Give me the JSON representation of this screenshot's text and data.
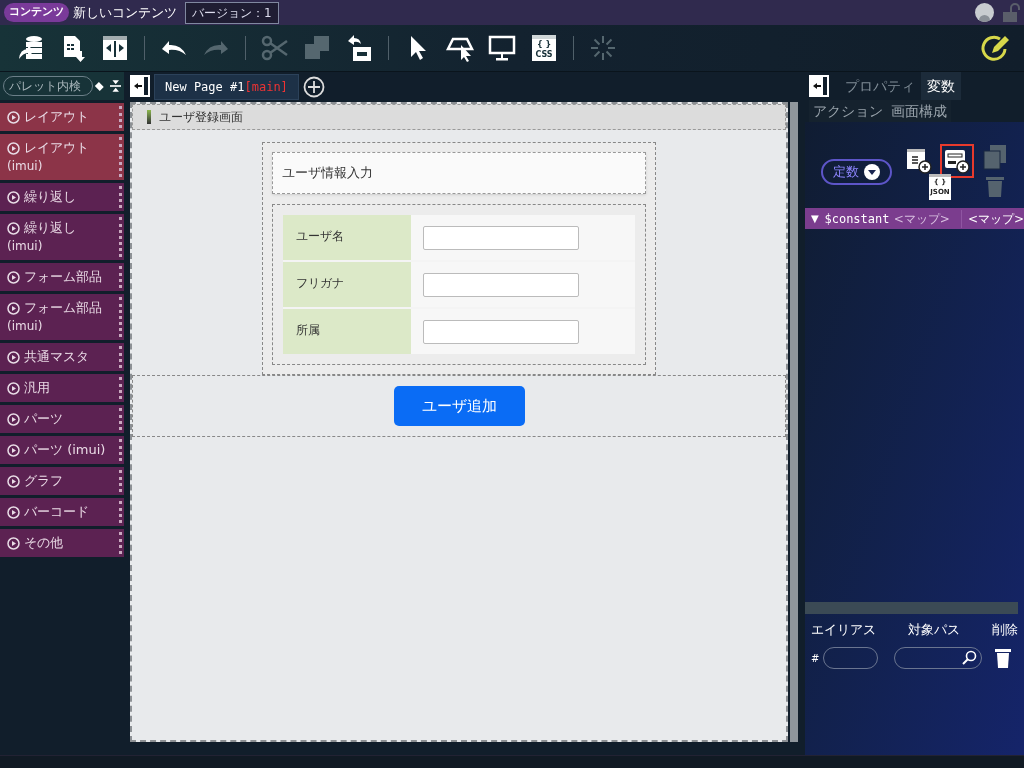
{
  "header": {
    "badge": "コンテンツ",
    "title": "新しいコンテンツ",
    "version": "バージョン：1"
  },
  "toolbar": {
    "groups": [
      [
        {
          "kind": "database",
          "disabled": false
        },
        {
          "kind": "table-export",
          "disabled": false
        },
        {
          "kind": "split",
          "disabled": false
        }
      ],
      [
        {
          "kind": "undo",
          "disabled": false
        },
        {
          "kind": "redo",
          "disabled": true
        }
      ],
      [
        {
          "kind": "cut",
          "disabled": true
        },
        {
          "kind": "copy",
          "disabled": true
        },
        {
          "kind": "paste",
          "disabled": false
        }
      ],
      [
        {
          "kind": "pointer",
          "disabled": false
        },
        {
          "kind": "area-pointer",
          "disabled": false
        },
        {
          "kind": "monitor",
          "disabled": false
        },
        {
          "kind": "css",
          "disabled": false,
          "glyph": "{ }",
          "label": "CSS"
        }
      ],
      [
        {
          "kind": "spinner",
          "disabled": true
        }
      ]
    ]
  },
  "palette": {
    "search": {
      "placeholder": "パレット内検"
    },
    "items": [
      {
        "label": "レイアウト",
        "color": "#8c3448"
      },
      {
        "label": "レイアウト",
        "sub": "(imui)",
        "color": "#8c3448"
      },
      {
        "label": "繰り返し",
        "color": "#5c2252"
      },
      {
        "label": "繰り返し",
        "sub": "(imui)",
        "color": "#5c2252"
      },
      {
        "label": "フォーム部品",
        "color": "#5c2252"
      },
      {
        "label": "フォーム部品",
        "sub": "(imui)",
        "color": "#5c2252"
      },
      {
        "label": "共通マスタ",
        "color": "#5c2252"
      },
      {
        "label": "汎用",
        "color": "#5c2252"
      },
      {
        "label": "パーツ",
        "color": "#5c2252"
      },
      {
        "label": "パーツ (imui)",
        "color": "#5c2252"
      },
      {
        "label": "グラフ",
        "color": "#5c2252"
      },
      {
        "label": "バーコード",
        "color": "#5c2252"
      },
      {
        "label": "その他",
        "color": "#5c2252"
      }
    ]
  },
  "page_tab": {
    "name": "New Page #1",
    "tag": "[main]"
  },
  "canvas": {
    "page_title": "ユーザ登録画面",
    "form_title": "ユーザ情報入力",
    "rows": [
      {
        "label": "ユーザ名"
      },
      {
        "label": "フリガナ"
      },
      {
        "label": "所属"
      }
    ],
    "button": "ユーザ追加"
  },
  "right_panel": {
    "tabs": [
      {
        "label": "プロパティ",
        "selected": false
      },
      {
        "label": "変数",
        "selected": true
      },
      {
        "label": "アクション",
        "selected": false
      },
      {
        "label": "画面構成",
        "selected": false
      }
    ],
    "scope": "定数",
    "json_icon": {
      "glyph": "{ }",
      "label": "JSON"
    },
    "tree_row": {
      "expander": "▼",
      "name": "$constant",
      "column_2": "<マップ>",
      "column_3": "<マップ>"
    },
    "columns": [
      "エイリアス",
      "対象パス",
      "削除"
    ],
    "alias_prefix": "#"
  }
}
